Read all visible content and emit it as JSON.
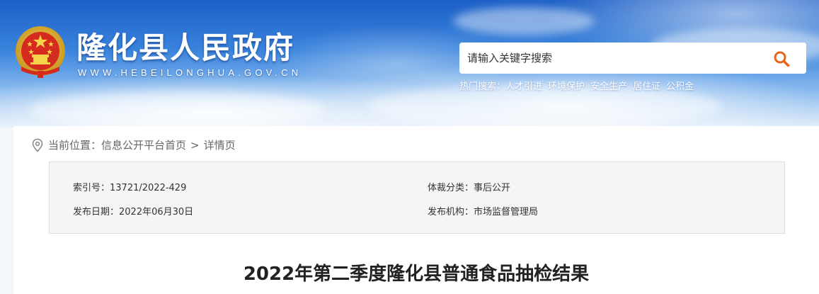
{
  "header": {
    "site_title": "隆化县人民政府",
    "site_url": "WWW.HEBEILONGHUA.GOV.CN",
    "emblem_icon": "national-emblem-icon"
  },
  "search": {
    "placeholder": "请输入关键字搜索",
    "button_icon": "search-icon",
    "accent_color": "#e8641a"
  },
  "hot_search": {
    "label": "热门搜索：",
    "items": [
      "人才引进",
      "环境保护",
      "安全生产",
      "居住证",
      "公积金"
    ]
  },
  "breadcrumb": {
    "prefix": "当前位置：",
    "items": [
      "信息公开平台首页",
      "详情页"
    ],
    "separator": ">"
  },
  "info": {
    "index_label": "索引号：",
    "index_value": "13721/2022-429",
    "date_label": "发布日期：",
    "date_value": "2022年06月30日",
    "genre_label": "体裁分类：",
    "genre_value": "事后公开",
    "org_label": "发布机构：",
    "org_value": "市场监督管理局"
  },
  "article": {
    "title": "2022年第二季度隆化县普通食品抽检结果"
  }
}
